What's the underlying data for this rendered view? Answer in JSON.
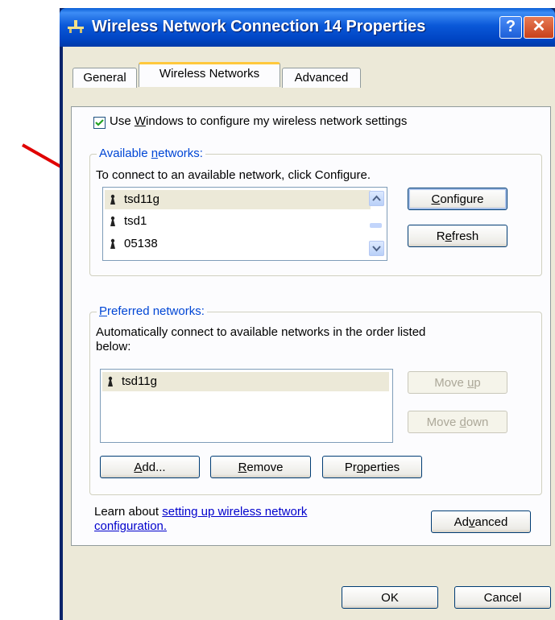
{
  "window": {
    "title": "Wireless Network Connection 14 Properties",
    "help_label": "?",
    "close_label": "✕"
  },
  "tabs": [
    {
      "label": "General"
    },
    {
      "label": "Wireless Networks"
    },
    {
      "label": "Advanced"
    }
  ],
  "checkbox": {
    "label_pre": "Use ",
    "label_accel": "W",
    "label_post": "indows to configure my wireless network settings",
    "checked": true
  },
  "available": {
    "group_title_pre": "Available ",
    "group_title_accel": "n",
    "group_title_post": "etworks:",
    "instruction": "To connect to an available network, click Configure.",
    "networks": [
      {
        "name": "tsd11g"
      },
      {
        "name": "tsd1"
      },
      {
        "name": "05138"
      }
    ],
    "configure_accel": "C",
    "configure_rest": "onfigure",
    "refresh_pre": "R",
    "refresh_accel": "e",
    "refresh_post": "fresh"
  },
  "preferred": {
    "group_title_accel": "P",
    "group_title_rest": "referred networks:",
    "instruction_line1": "Automatically connect to available networks in the order listed",
    "instruction_line2": "below:",
    "networks": [
      {
        "name": "tsd11g"
      }
    ],
    "move_up_pre": "Move ",
    "move_up_accel": "u",
    "move_up_post": "p",
    "move_down_pre": "Move ",
    "move_down_accel": "d",
    "move_down_post": "own",
    "add_accel": "A",
    "add_rest": "dd...",
    "remove_accel": "R",
    "remove_rest": "emove",
    "properties_pre": "Pr",
    "properties_accel": "o",
    "properties_post": "perties"
  },
  "learn": {
    "prefix": "Learn about ",
    "link_line1": "setting up wireless network",
    "link_line2": "configuration."
  },
  "advanced_button": {
    "pre": "Ad",
    "accel": "v",
    "post": "anced"
  },
  "footer": {
    "ok": "OK",
    "cancel": "Cancel"
  },
  "colors": {
    "title_bar": "#0a58d8",
    "group_title": "#0046d5",
    "dialog_bg": "#ece9d8",
    "annotation_arrow": "#e00000",
    "link": "#0000cc"
  }
}
